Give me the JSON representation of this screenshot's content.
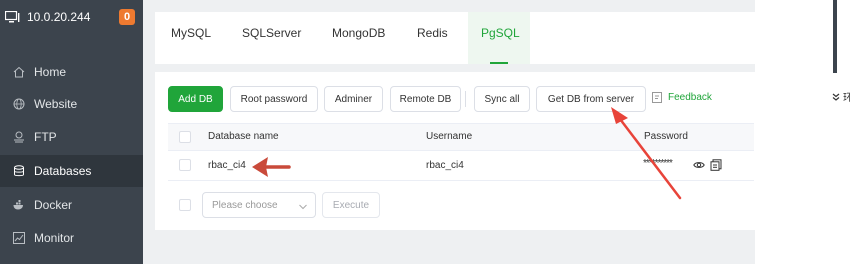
{
  "server": {
    "ip": "10.0.20.244",
    "badge": "0"
  },
  "sidebar": {
    "items": [
      {
        "label": "Home",
        "icon": "home-icon",
        "active": false
      },
      {
        "label": "Website",
        "icon": "globe-icon",
        "active": false
      },
      {
        "label": "FTP",
        "icon": "ftp-icon",
        "active": false
      },
      {
        "label": "Databases",
        "icon": "database-icon",
        "active": true
      },
      {
        "label": "Docker",
        "icon": "docker-icon",
        "active": false
      },
      {
        "label": "Monitor",
        "icon": "monitor-icon",
        "active": false
      }
    ]
  },
  "tabs": [
    {
      "label": "MySQL"
    },
    {
      "label": "SQLServer"
    },
    {
      "label": "MongoDB"
    },
    {
      "label": "Redis"
    },
    {
      "label": "PgSQL",
      "active": true
    }
  ],
  "toolbar": {
    "add_db": "Add DB",
    "root_password": "Root password",
    "adminer": "Adminer",
    "remote_db": "Remote DB",
    "sync_all": "Sync all",
    "get_db_from_server": "Get DB from server",
    "feedback": "Feedback"
  },
  "table": {
    "headers": {
      "name": "Database name",
      "username": "Username",
      "password": "Password"
    },
    "rows": [
      {
        "name": "rbac_ci4",
        "username": "rbac_ci4",
        "password": "**********"
      }
    ]
  },
  "batch": {
    "placeholder": "Please choose",
    "execute": "Execute"
  },
  "right_panel": {
    "label": "环"
  },
  "colors": {
    "accent": "#20a53a",
    "sidebar": "#3c444d",
    "annotation": "#c94a3a",
    "badge": "#ee7a30"
  }
}
